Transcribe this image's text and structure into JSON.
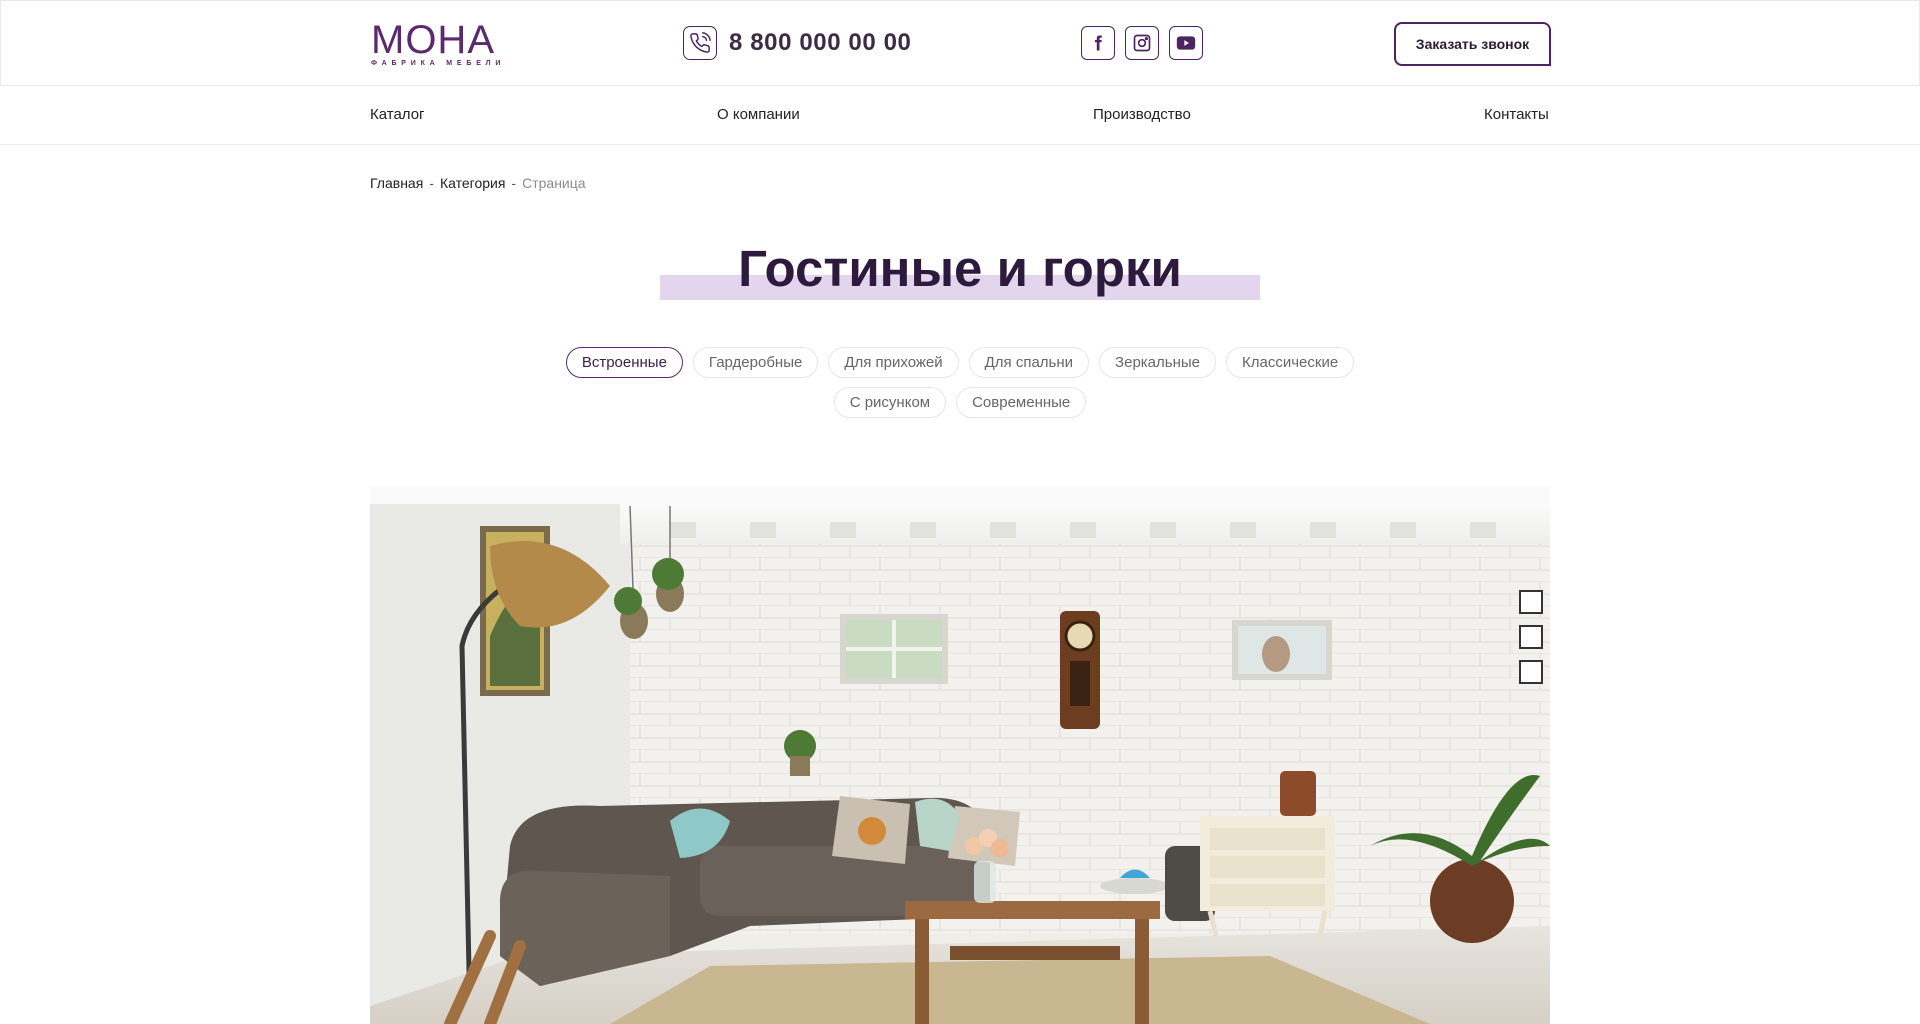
{
  "header": {
    "logo": {
      "main": "МОНА",
      "sub": "ФАБРИКА МЕБЕЛИ"
    },
    "phone": "8 800 000 00 00",
    "socials": [
      {
        "icon": "facebook-icon"
      },
      {
        "icon": "instagram-icon"
      },
      {
        "icon": "youtube-icon"
      }
    ],
    "callback_label": "Заказать звонок"
  },
  "nav": [
    {
      "label": "Каталог"
    },
    {
      "label": "О компании"
    },
    {
      "label": "Производство"
    },
    {
      "label": "Контакты"
    }
  ],
  "breadcrumb": {
    "items": [
      "Главная",
      "Категория"
    ],
    "separator": "-",
    "current": "Страница"
  },
  "page_title": "Гостиные и горки",
  "filters": [
    {
      "label": "Встроенные",
      "active": true
    },
    {
      "label": "Гардеробные"
    },
    {
      "label": "Для прихожей"
    },
    {
      "label": "Для спальни"
    },
    {
      "label": "Зеркальные"
    },
    {
      "label": "Классические"
    },
    {
      "label": "С рисунком"
    },
    {
      "label": "Современные"
    }
  ],
  "colors": {
    "brand": "#5b2a6e",
    "title": "#2e1a3d",
    "title_highlight": "#e4d5ee"
  }
}
